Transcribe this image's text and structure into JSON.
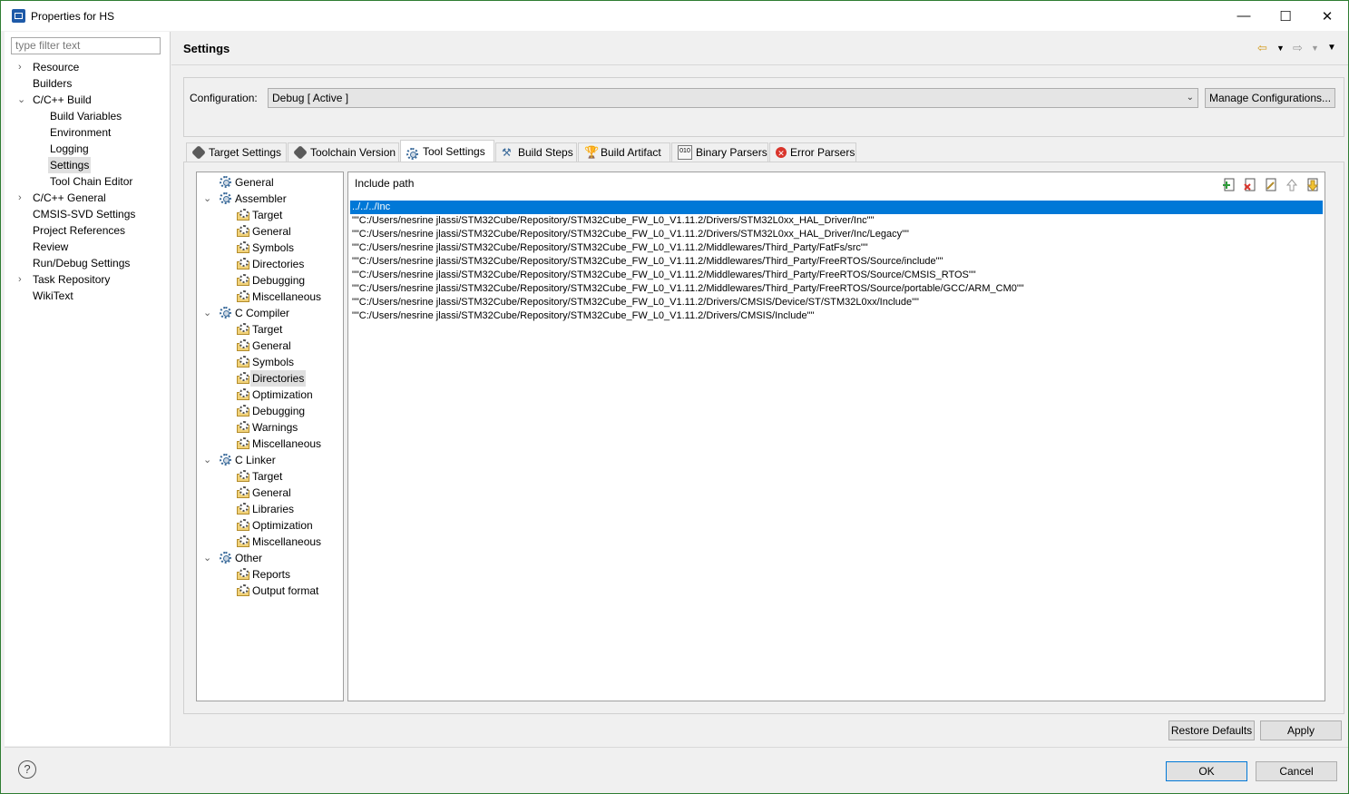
{
  "window": {
    "title": "Properties for HS",
    "minimize": "—",
    "maximize": "☐",
    "close": "✕"
  },
  "filter": {
    "placeholder": "type filter text"
  },
  "nav": {
    "items": [
      {
        "label": "Resource"
      },
      {
        "label": "Builders"
      },
      {
        "label": "C/C++ Build"
      },
      {
        "label": "Build Variables"
      },
      {
        "label": "Environment"
      },
      {
        "label": "Logging"
      },
      {
        "label": "Settings"
      },
      {
        "label": "Tool Chain Editor"
      },
      {
        "label": "C/C++ General"
      },
      {
        "label": "CMSIS-SVD Settings"
      },
      {
        "label": "Project References"
      },
      {
        "label": "Review"
      },
      {
        "label": "Run/Debug Settings"
      },
      {
        "label": "Task Repository"
      },
      {
        "label": "WikiText"
      }
    ]
  },
  "page": {
    "title": "Settings"
  },
  "config": {
    "label": "Configuration:",
    "value": "Debug  [ Active ]",
    "manage_label": "Manage Configurations..."
  },
  "tabs": [
    {
      "label": "Target Settings"
    },
    {
      "label": "Toolchain Version"
    },
    {
      "label": "Tool Settings"
    },
    {
      "label": "Build Steps"
    },
    {
      "label": "Build Artifact"
    },
    {
      "label": "Binary Parsers"
    },
    {
      "label": "Error Parsers"
    }
  ],
  "tool_tree": [
    {
      "label": "General"
    },
    {
      "label": "Assembler"
    },
    {
      "label": "Target"
    },
    {
      "label": "General"
    },
    {
      "label": "Symbols"
    },
    {
      "label": "Directories"
    },
    {
      "label": "Debugging"
    },
    {
      "label": "Miscellaneous"
    },
    {
      "label": "C Compiler"
    },
    {
      "label": "Target"
    },
    {
      "label": "General"
    },
    {
      "label": "Symbols"
    },
    {
      "label": "Directories"
    },
    {
      "label": "Optimization"
    },
    {
      "label": "Debugging"
    },
    {
      "label": "Warnings"
    },
    {
      "label": "Miscellaneous"
    },
    {
      "label": "C Linker"
    },
    {
      "label": "Target"
    },
    {
      "label": "General"
    },
    {
      "label": "Libraries"
    },
    {
      "label": "Optimization"
    },
    {
      "label": "Miscellaneous"
    },
    {
      "label": "Other"
    },
    {
      "label": "Reports"
    },
    {
      "label": "Output format"
    }
  ],
  "include": {
    "title": "Include path",
    "paths": [
      "../../../Inc",
      "\"\"C:/Users/nesrine jlassi/STM32Cube/Repository/STM32Cube_FW_L0_V1.11.2/Drivers/STM32L0xx_HAL_Driver/Inc\"\"",
      "\"\"C:/Users/nesrine jlassi/STM32Cube/Repository/STM32Cube_FW_L0_V1.11.2/Drivers/STM32L0xx_HAL_Driver/Inc/Legacy\"\"",
      "\"\"C:/Users/nesrine jlassi/STM32Cube/Repository/STM32Cube_FW_L0_V1.11.2/Middlewares/Third_Party/FatFs/src\"\"",
      "\"\"C:/Users/nesrine jlassi/STM32Cube/Repository/STM32Cube_FW_L0_V1.11.2/Middlewares/Third_Party/FreeRTOS/Source/include\"\"",
      "\"\"C:/Users/nesrine jlassi/STM32Cube/Repository/STM32Cube_FW_L0_V1.11.2/Middlewares/Third_Party/FreeRTOS/Source/CMSIS_RTOS\"\"",
      "\"\"C:/Users/nesrine jlassi/STM32Cube/Repository/STM32Cube_FW_L0_V1.11.2/Middlewares/Third_Party/FreeRTOS/Source/portable/GCC/ARM_CM0\"\"",
      "\"\"C:/Users/nesrine jlassi/STM32Cube/Repository/STM32Cube_FW_L0_V1.11.2/Drivers/CMSIS/Device/ST/STM32L0xx/Include\"\"",
      "\"\"C:/Users/nesrine jlassi/STM32Cube/Repository/STM32Cube_FW_L0_V1.11.2/Drivers/CMSIS/Include\"\""
    ]
  },
  "buttons": {
    "restore_defaults": "Restore Defaults",
    "apply": "Apply",
    "ok": "OK",
    "cancel": "Cancel",
    "help": "?"
  },
  "colors": {
    "selection": "#0078d7",
    "frame": "#2f7d32"
  }
}
